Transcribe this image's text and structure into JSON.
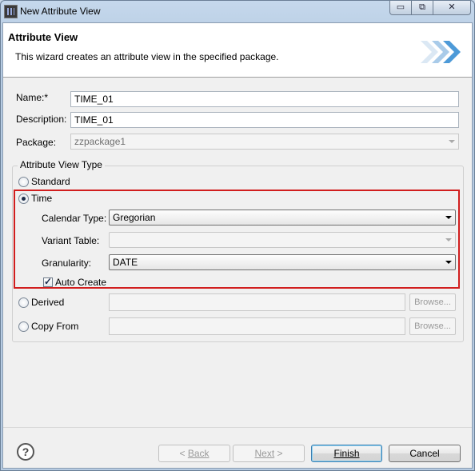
{
  "window": {
    "title": "New Attribute View",
    "controls": {
      "minimize": "▭",
      "maximize": "⧉",
      "close": "✕"
    }
  },
  "header": {
    "title": "Attribute View",
    "description": "This wizard creates an attribute view in the specified package."
  },
  "form": {
    "name_label": "Name:*",
    "name_value": "TIME_01",
    "description_label": "Description:",
    "description_value": "TIME_01",
    "package_label": "Package:",
    "package_value": "zzpackage1"
  },
  "attribute_view_type": {
    "group_title": "Attribute View Type",
    "options": {
      "standard": "Standard",
      "time": "Time",
      "derived": "Derived",
      "copy_from": "Copy From"
    },
    "selected": "Time",
    "time": {
      "calendar_type_label": "Calendar Type:",
      "calendar_type_value": "Gregorian",
      "variant_table_label": "Variant Table:",
      "variant_table_value": "",
      "granularity_label": "Granularity:",
      "granularity_value": "DATE",
      "auto_create_label": "Auto Create",
      "auto_create_checked": true
    },
    "browse_label": "Browse..."
  },
  "buttons": {
    "help": "?",
    "back": "Back",
    "back_prefix": "< ",
    "next": "Next",
    "next_suffix": " >",
    "finish": "Finish",
    "cancel": "Cancel"
  },
  "colors": {
    "highlight_border": "#d11e1e"
  }
}
